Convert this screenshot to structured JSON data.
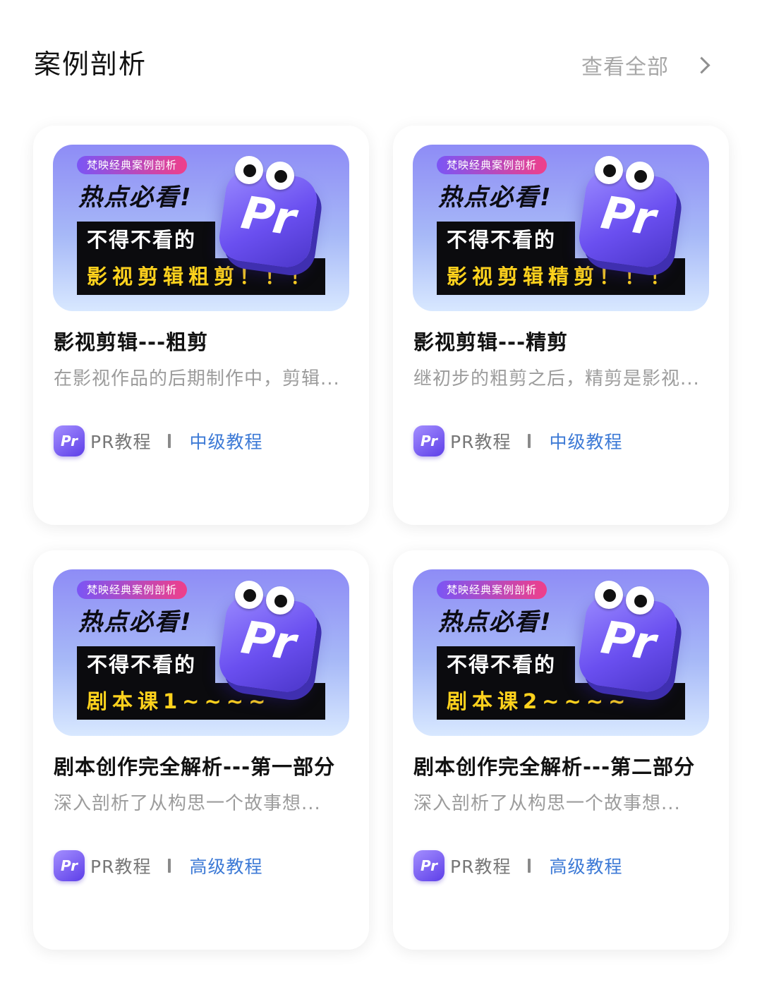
{
  "header": {
    "title": "案例剖析",
    "view_all": "查看全部",
    "view_all_icon": "chevron-right-icon"
  },
  "colors": {
    "accent_link": "#3d7ad6",
    "muted_text": "#9c9c9c",
    "pr_purple": "#6a4ff0",
    "highlight_yellow": "#ffd21d"
  },
  "cards": [
    {
      "thumb": {
        "badge": "梵映经典案例剖析",
        "hot": "热点必看!",
        "line1": "不得不看的",
        "line2": "影视剪辑粗剪！！！",
        "logo": "Pr"
      },
      "title": "影视剪辑---粗剪",
      "desc": "在影视作品的后期制作中，剪辑...",
      "icon": "Pr",
      "category": "PR教程",
      "level": "中级教程"
    },
    {
      "thumb": {
        "badge": "梵映经典案例剖析",
        "hot": "热点必看!",
        "line1": "不得不看的",
        "line2": "影视剪辑精剪！！！",
        "logo": "Pr"
      },
      "title": "影视剪辑---精剪",
      "desc": "继初步的粗剪之后，精剪是影视...",
      "icon": "Pr",
      "category": "PR教程",
      "level": "中级教程"
    },
    {
      "thumb": {
        "badge": "梵映经典案例剖析",
        "hot": "热点必看!",
        "line1": "不得不看的",
        "line2": "剧本课1~~~~",
        "logo": "Pr"
      },
      "title": "剧本创作完全解析---第一部分",
      "desc": "深入剖析了从构思一个故事想...",
      "icon": "Pr",
      "category": "PR教程",
      "level": "高级教程"
    },
    {
      "thumb": {
        "badge": "梵映经典案例剖析",
        "hot": "热点必看!",
        "line1": "不得不看的",
        "line2": "剧本课2~~~~",
        "logo": "Pr"
      },
      "title": "剧本创作完全解析---第二部分",
      "desc": "深入剖析了从构思一个故事想...",
      "icon": "Pr",
      "category": "PR教程",
      "level": "高级教程"
    }
  ]
}
